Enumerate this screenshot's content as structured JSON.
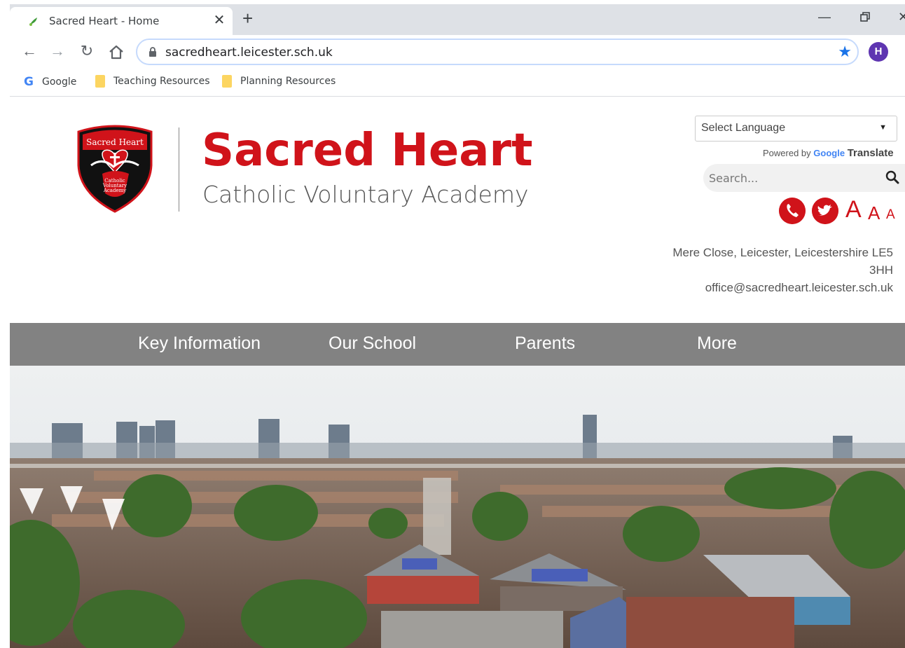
{
  "browser": {
    "tab_title": "Sacred Heart - Home",
    "url": "sacredheart.leicester.sch.uk",
    "profile_initial": "H",
    "bookmarks": [
      "Google",
      "Teaching Resources",
      "Planning Resources"
    ]
  },
  "header": {
    "school_name": "Sacred Heart",
    "school_subtitle": "Catholic Voluntary Academy",
    "crest_text": [
      "Sacred Heart",
      "Catholic",
      "Voluntary",
      "Academy"
    ],
    "language_select": "Select Language",
    "powered_by": "Powered by",
    "google_word": "Google",
    "translate_word": "Translate",
    "search_placeholder": "Search...",
    "text_size_labels": [
      "A",
      "A",
      "A"
    ],
    "address_line1": "Mere Close, Leicester, Leicestershire LE5",
    "address_line2": "3HH",
    "email": "office@sacredheart.leicester.sch.uk"
  },
  "nav": {
    "items": [
      "Key Information",
      "Our School",
      "Parents",
      "More"
    ]
  },
  "colors": {
    "brand_red": "#d0131a",
    "nav_grey": "#828282"
  }
}
